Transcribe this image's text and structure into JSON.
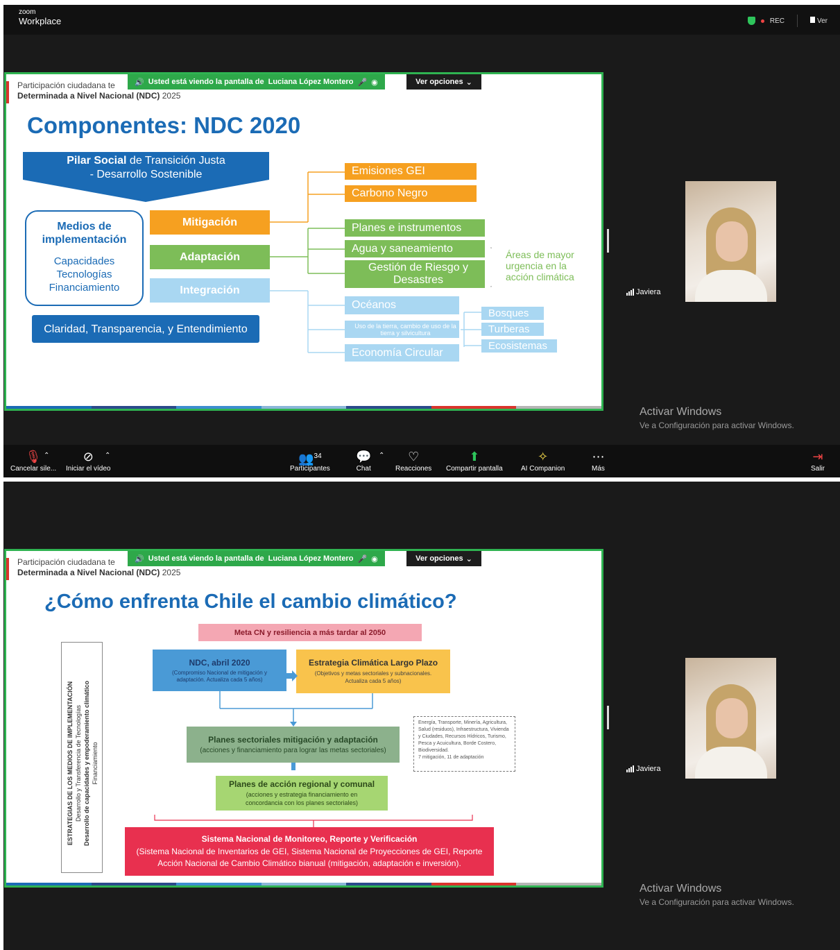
{
  "app": {
    "brand_small": "zoom",
    "brand": "Workplace",
    "rec": "REC",
    "view": "Ver"
  },
  "share": {
    "prefix": "Usted está viendo la pantalla de",
    "presenter": "Luciana López Montero",
    "options": "Ver opciones"
  },
  "slide_header": {
    "line1": "Participación ciudadana te",
    "line2_bold": "Determinada a Nivel Nacional (NDC)",
    "line2_year": "2025"
  },
  "slide1": {
    "title": "Componentes: NDC 2020",
    "pilar_bold": "Pilar Social",
    "pilar_rest": "de Transición Justa",
    "pilar_line2": "- Desarrollo Sostenible",
    "medios_title": "Medios de implementación",
    "medios_items": "Capacidades Tecnologías Financiamiento",
    "mitigacion": "Mitigación",
    "adaptacion": "Adaptación",
    "integracion": "Integración",
    "claridad": "Claridad, Transparencia, y Entendimiento",
    "emisiones": "Emisiones GEI",
    "carbono": "Carbono Negro",
    "planes": "Planes e instrumentos",
    "agua": "Agua y saneamiento",
    "gestion": "Gestión de Riesgo y Desastres",
    "areas": "Áreas de mayor urgencia en la acción climática",
    "oceanos": "Océanos",
    "uso_tierra": "Uso de la tierra, cambio de uso de la tierra y silvicultura",
    "economia": "Economía Circular",
    "bosques": "Bosques",
    "turberas": "Turberas",
    "ecosistemas": "Ecosistemas"
  },
  "slide2": {
    "title": "¿Cómo enfrenta Chile el cambio climático?",
    "meta": "Meta CN y resiliencia a más tardar al 2050",
    "ndc_title": "NDC, abril 2020",
    "ndc_sub": "(Compromiso Nacional de mitigación y adaptación. Actualiza cada 5 años)",
    "elp_title": "Estrategia Climática Largo Plazo",
    "elp_sub": "(Objetivos y metas sectoriales y subnacionales. Actualiza cada 5 años)",
    "planes_sect_title": "Planes sectoriales mitigación y adaptación",
    "planes_sect_sub": "(acciones y financiamiento para lograr las metas sectoriales)",
    "sectores": "Energía, Transporte, Minería, Agricultura, Salud (residuos), Infraestructura, Vivienda y Ciudades, Recursos Hídricos, Turismo, Pesca y Acuicultura, Borde Costero, Biodiversidad.",
    "sectores_count": "7 mitigación, 11 de adaptación",
    "planes_reg_title": "Planes de acción regional y comunal",
    "planes_reg_sub": "(acciones y estrategia financiamiento en concordancia con los planes sectoriales)",
    "sistema_title": "Sistema Nacional de Monitoreo, Reporte y Verificación",
    "sistema_sub": "(Sistema Nacional de Inventarios de GEI, Sistema Nacional de Proyecciones de GEI, Reporte Acción Nacional de Cambio Climático bianual (mitigación, adaptación e inversión).",
    "vertical_1": "ESTRATEGIAS DE LOS MEDIOS DE IMPLEMENTACIÓN",
    "vertical_2": "Desarrollo y Transferencia de Tecnologías",
    "vertical_3": "Desarrollo de capacidades y empoderamiento climático",
    "vertical_4": "Financiamiento"
  },
  "participant": {
    "name": "Javiera"
  },
  "activate": {
    "title": "Activar Windows",
    "sub": "Ve a Configuración para activar Windows."
  },
  "toolbar": {
    "mute": "Cancelar sile...",
    "video": "Iniciar el vídeo",
    "participants": "Participantes",
    "participants_count": "34",
    "chat": "Chat",
    "reactions": "Reacciones",
    "share": "Compartir pantalla",
    "ai": "AI Companion",
    "more": "Más",
    "leave": "Salir"
  },
  "colors": {
    "green": "#2fb351",
    "blue": "#1b6bb5",
    "orange": "#f6a020",
    "lightgreen": "#7dbd58",
    "lightblue": "#a9d7f2",
    "red": "#e8304f"
  }
}
